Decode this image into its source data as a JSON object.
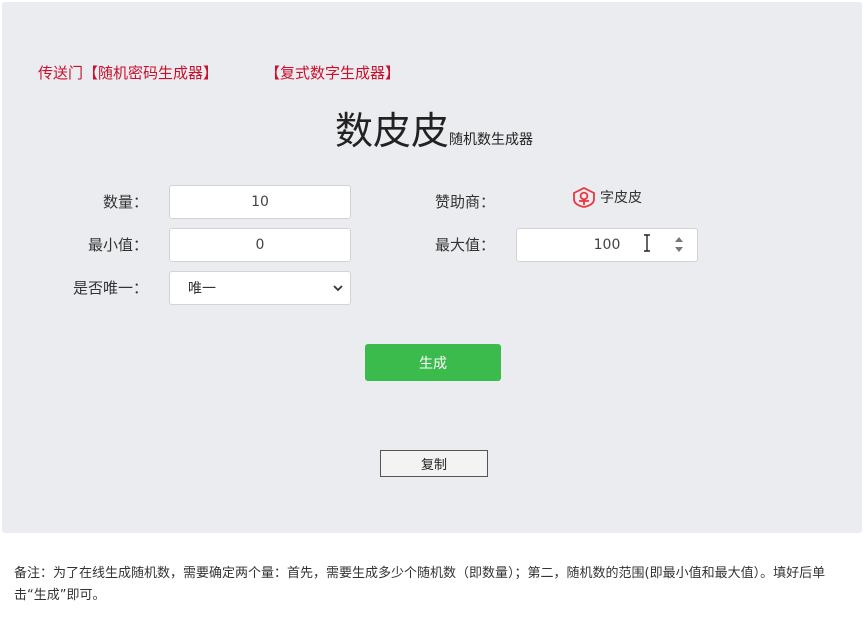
{
  "header": {
    "link_password": "传送门【随机密码生成器】",
    "link_multiple": "【复式数字生成器】"
  },
  "title": {
    "main": "数皮皮",
    "sub": "随机数生成器"
  },
  "form": {
    "quantity_label": "数量：",
    "quantity_value": "10",
    "min_label": "最小值：",
    "min_value": "0",
    "max_label": "最大值：",
    "max_value": "100",
    "unique_label": "是否唯一：",
    "unique_selected": "唯一",
    "sponsor_label": "赞助商：",
    "sponsor_name": "字皮皮"
  },
  "buttons": {
    "generate": "生成",
    "copy": "复制"
  },
  "note": "备注：为了在线生成随机数，需要确定两个量：首先，需要生成多少个随机数（即数量）；第二，随机数的范围(即最小值和最大值）。填好后单击“生成”即可。",
  "colors": {
    "link": "#c8102e",
    "generate_button": "#3bbb4b",
    "panel_background": "#ebecef",
    "sponsor_logo": "#e8363d"
  },
  "icons": [
    "sponsor-logo-icon",
    "chevron-down-icon",
    "spinner-arrows-icon",
    "text-cursor-icon"
  ]
}
